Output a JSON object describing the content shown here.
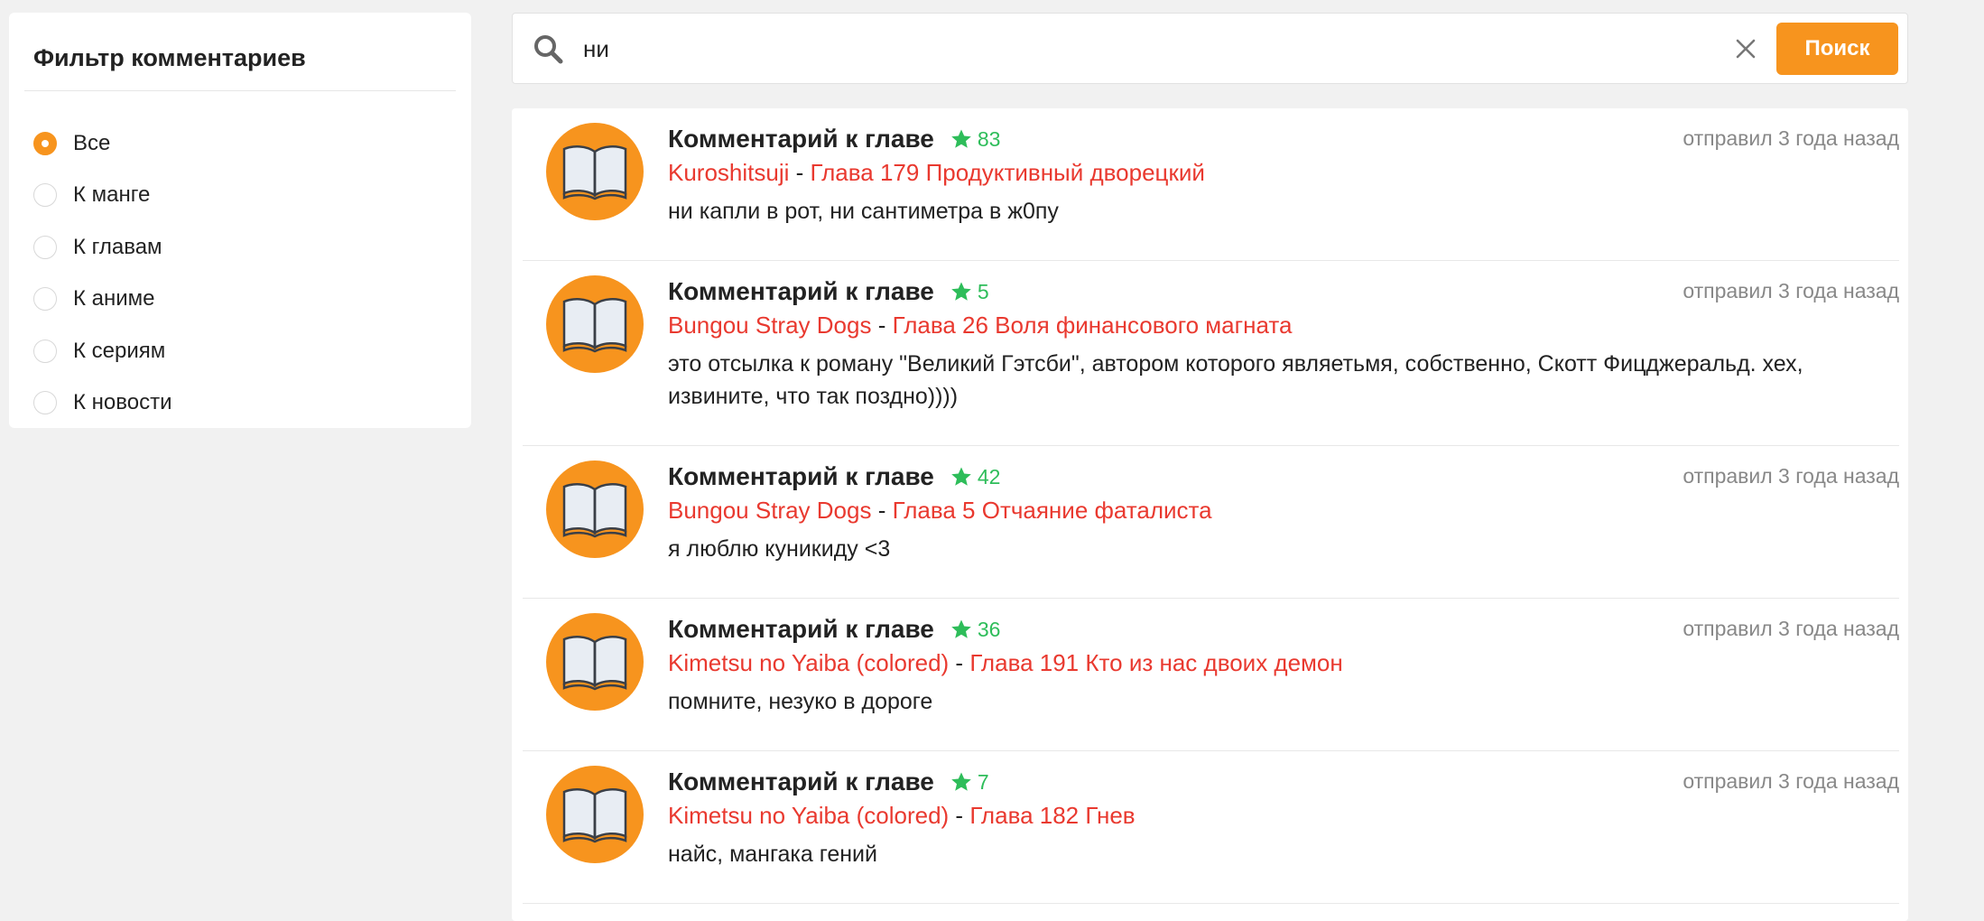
{
  "filter": {
    "title": "Фильтр комментариев",
    "options": [
      {
        "label": "Все",
        "selected": true
      },
      {
        "label": "К манге",
        "selected": false
      },
      {
        "label": "К главам",
        "selected": false
      },
      {
        "label": "К аниме",
        "selected": false
      },
      {
        "label": "К сериям",
        "selected": false
      },
      {
        "label": "К новости",
        "selected": false
      }
    ]
  },
  "search": {
    "value": "ни",
    "button_label": "Поиск"
  },
  "comments": [
    {
      "type": "Комментарий к главе",
      "rating": "83",
      "posted": "отправил 3 года назад",
      "manga": "Kuroshitsuji",
      "separator": " - ",
      "chapter": "Глава 179 Продуктивный дворецкий",
      "text": "ни капли в рот, ни сантиметра в ж0пу"
    },
    {
      "type": "Комментарий к главе",
      "rating": "5",
      "posted": "отправил 3 года назад",
      "manga": "Bungou Stray Dogs",
      "separator": " - ",
      "chapter": "Глава 26 Воля финансового магната",
      "text": "это отсылка к роману \"Великий Гэтсби\", автором которого являетьмя, собственно, Скотт Фицджеральд. хех, извините, что так поздно))))"
    },
    {
      "type": "Комментарий к главе",
      "rating": "42",
      "posted": "отправил 3 года назад",
      "manga": "Bungou Stray Dogs",
      "separator": " - ",
      "chapter": "Глава 5 Отчаяние фаталиста",
      "text": "я люблю куникиду <3"
    },
    {
      "type": "Комментарий к главе",
      "rating": "36",
      "posted": "отправил 3 года назад",
      "manga": "Kimetsu no Yaiba (colored)",
      "separator": " - ",
      "chapter": "Глава 191 Кто из нас двоих демон",
      "text": "помните, незуко в дороге"
    },
    {
      "type": "Комментарий к главе",
      "rating": "7",
      "posted": "отправил 3 года назад",
      "manga": "Kimetsu no Yaiba (colored)",
      "separator": " - ",
      "chapter": "Глава 182 Гнев",
      "text": "найс, мангака гений"
    }
  ],
  "colors": {
    "accent": "#f7941e",
    "link": "#e9392f",
    "rating": "#2ebd5a",
    "muted": "#888888",
    "background": "#f1f1f1"
  },
  "icons": {
    "search": "search-icon",
    "clear": "close-icon",
    "star": "star-icon",
    "avatar": "open-book-icon"
  }
}
